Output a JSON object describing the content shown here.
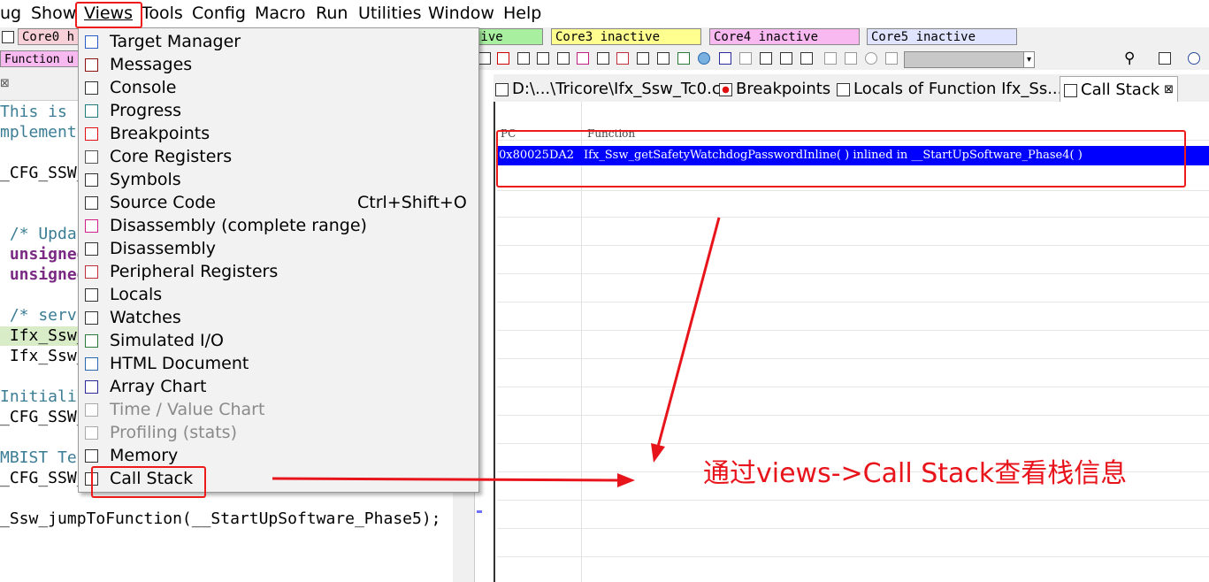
{
  "menubar": [
    "ug",
    "Show",
    "Views",
    "Tools",
    "Config",
    "Macro",
    "Run",
    "Utilities",
    "Window",
    "Help"
  ],
  "toolbar": {
    "cores": [
      "Core0 h",
      "tive",
      "Core3 inactive",
      "Core4 inactive",
      "Core5 inactive"
    ],
    "function_label": "Function u",
    "search_icon": "search-icon"
  },
  "editor": {
    "lines": [
      {
        "text": "This is f",
        "style": "cm"
      },
      {
        "text": "mplement",
        "style": "cm"
      },
      {
        "text": "",
        "style": ""
      },
      {
        "text": "_CFG_SSW_",
        "style": ""
      },
      {
        "text": "",
        "style": ""
      },
      {
        "text": "",
        "style": ""
      },
      {
        "text": " /* Updat",
        "style": "cm"
      },
      {
        "text": " unsigned",
        "style": "kw"
      },
      {
        "text": " unsigned",
        "style": "kw"
      },
      {
        "text": "",
        "style": ""
      },
      {
        "text": " /* servi",
        "style": "cm"
      },
      {
        "text": " Ifx_Ssw_",
        "style": "hl"
      },
      {
        "text": " Ifx_Ssw_",
        "style": ""
      },
      {
        "text": "",
        "style": ""
      },
      {
        "text": "Initializ",
        "style": "cm"
      },
      {
        "text": "_CFG_SSW_",
        "style": ""
      },
      {
        "text": "",
        "style": ""
      },
      {
        "text": "MBIST Tes",
        "style": "cm"
      },
      {
        "text": "_CFG_SSW_CALLOUT_MBIST();",
        "style": ""
      },
      {
        "text": "",
        "style": ""
      },
      {
        "text": "_Ssw_jumpToFunction(__StartUpSoftware_Phase5);",
        "style": ""
      }
    ]
  },
  "tabs": [
    {
      "label": "D:\\...\\Tricore\\Ifx_Ssw_Tc0.c",
      "icon": "source-file-icon"
    },
    {
      "label": "Breakpoints",
      "icon": "breakpoint-icon"
    },
    {
      "label": "Locals of Function Ifx_Ss...",
      "icon": "locals-icon"
    },
    {
      "label": "Call Stack",
      "icon": "call-stack-icon",
      "close": "⊠"
    }
  ],
  "callstack": {
    "columns": [
      "PC",
      "Function"
    ],
    "rows": [
      {
        "pc": "0x80025DA2",
        "function": "Ifx_Ssw_getSafetyWatchdogPasswordInline( ) inlined in __StartUpSoftware_Phase4( )"
      }
    ]
  },
  "views_menu": [
    {
      "label": "Target Manager",
      "shortcut": "",
      "enabled": true,
      "icon": "target-manager-icon",
      "color": "#2a5cc7"
    },
    {
      "label": "Messages",
      "shortcut": "",
      "enabled": true,
      "icon": "messages-icon",
      "color": "#8b1010"
    },
    {
      "label": "Console",
      "shortcut": "",
      "enabled": true,
      "icon": "console-icon",
      "color": "#333333"
    },
    {
      "label": "Progress",
      "shortcut": "",
      "enabled": true,
      "icon": "progress-icon",
      "color": "#1f7d7d"
    },
    {
      "label": "Breakpoints",
      "shortcut": "",
      "enabled": true,
      "icon": "breakpoint-icon",
      "color": "#e01010"
    },
    {
      "label": "Core Registers",
      "shortcut": "",
      "enabled": true,
      "icon": "core-registers-icon",
      "color": "#555555"
    },
    {
      "label": "Symbols",
      "shortcut": "",
      "enabled": true,
      "icon": "symbols-icon",
      "color": "#333333"
    },
    {
      "label": "Source Code",
      "shortcut": "Ctrl+Shift+O",
      "enabled": true,
      "icon": "source-code-icon",
      "color": "#333333"
    },
    {
      "label": "Disassembly (complete range)",
      "shortcut": "",
      "enabled": true,
      "icon": "disassembly-range-icon",
      "color": "#d0208a"
    },
    {
      "label": "Disassembly",
      "shortcut": "",
      "enabled": true,
      "icon": "disassembly-icon",
      "color": "#333333"
    },
    {
      "label": "Peripheral Registers",
      "shortcut": "",
      "enabled": true,
      "icon": "peripheral-registers-icon",
      "color": "#c0303a"
    },
    {
      "label": "Locals",
      "shortcut": "",
      "enabled": true,
      "icon": "locals-icon",
      "color": "#333333"
    },
    {
      "label": "Watches",
      "shortcut": "",
      "enabled": true,
      "icon": "watches-icon",
      "color": "#333333"
    },
    {
      "label": "Simulated I/O",
      "shortcut": "",
      "enabled": true,
      "icon": "simulated-io-icon",
      "color": "#2a7a3a"
    },
    {
      "label": "HTML Document",
      "shortcut": "",
      "enabled": true,
      "icon": "globe-icon",
      "color": "#2a6ab0"
    },
    {
      "label": "Array Chart",
      "shortcut": "",
      "enabled": true,
      "icon": "array-chart-icon",
      "color": "#2a2a9a"
    },
    {
      "label": "Time / Value Chart",
      "shortcut": "",
      "enabled": false,
      "icon": "time-value-chart-icon",
      "color": "#aaaaaa"
    },
    {
      "label": "Profiling (stats)",
      "shortcut": "",
      "enabled": false,
      "icon": "profiling-icon",
      "color": "#aaaaaa"
    },
    {
      "label": "Memory",
      "shortcut": "",
      "enabled": true,
      "icon": "memory-icon",
      "color": "#333333"
    },
    {
      "label": "Call Stack",
      "shortcut": "",
      "enabled": true,
      "icon": "call-stack-icon",
      "color": "#333333"
    }
  ],
  "annotation": {
    "text": "通过views->Call Stack查看栈信息",
    "color": "#e8141b"
  }
}
